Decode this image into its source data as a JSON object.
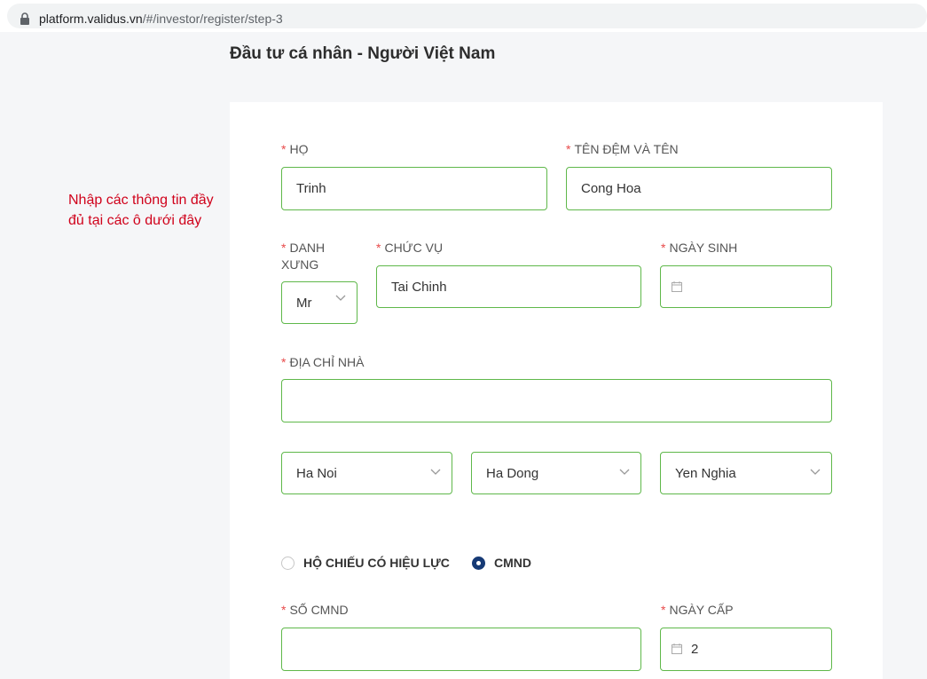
{
  "browser": {
    "url_host": "platform.validus.vn",
    "url_path": "/#/investor/register/step-3"
  },
  "page": {
    "title": "Đầu tư cá nhân - Người Việt Nam"
  },
  "annotation": {
    "text": "Nhập các thông tin đầy đủ tại các ô dưới đây",
    "color": "#d0021b"
  },
  "form": {
    "required_mark": "*",
    "ho": {
      "label": "HỌ",
      "value": "Trinh"
    },
    "ten_dem_va_ten": {
      "label": "TÊN ĐỆM VÀ TÊN",
      "value": "Cong Hoa"
    },
    "danh_xung": {
      "label": "DANH XƯNG",
      "value": "Mr"
    },
    "chuc_vu": {
      "label": "CHỨC VỤ",
      "value": "Tai Chinh"
    },
    "ngay_sinh": {
      "label": "NGÀY SINH",
      "value": ""
    },
    "dia_chi_nha": {
      "label": "ĐỊA CHỈ NHÀ",
      "value": ""
    },
    "tinh": {
      "value": "Ha Noi"
    },
    "quan": {
      "value": "Ha Dong"
    },
    "phuong": {
      "value": "Yen Nghia"
    },
    "id_type": {
      "options": [
        {
          "label": "HỘ CHIẾU CÓ HIỆU LỰC",
          "selected": false
        },
        {
          "label": "CMND",
          "selected": true
        }
      ]
    },
    "so_cmnd": {
      "label": "SỐ CMND",
      "value": ""
    },
    "ngay_cap": {
      "label": "NGÀY CẤP",
      "value": "2"
    }
  },
  "colors": {
    "field_border": "#5fb84a",
    "required": "#e84a4a",
    "radio_selected": "#163a75"
  },
  "icons": {
    "lock": "lock-icon",
    "calendar": "calendar-icon",
    "chevron": "chevron-down-icon"
  }
}
